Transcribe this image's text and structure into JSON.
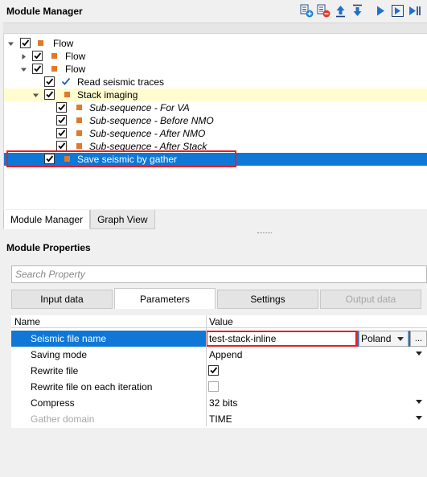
{
  "module_manager": {
    "title": "Module Manager",
    "toolbar": [
      {
        "icon": "add-module-icon"
      },
      {
        "icon": "remove-module-icon"
      },
      {
        "icon": "move-up-icon"
      },
      {
        "icon": "move-down-icon"
      },
      {
        "icon": "run-icon"
      },
      {
        "icon": "run-selected-icon"
      },
      {
        "icon": "run-to-end-icon"
      }
    ],
    "tree": {
      "root": "Flow",
      "flow_1": "Flow",
      "flow_2": "Flow",
      "read_traces": "Read seismic traces",
      "stack_imaging": "Stack imaging",
      "sub_va": "Sub-sequence - For VA",
      "sub_before_nmo": "Sub-sequence - Before NMO",
      "sub_after_nmo": "Sub-sequence - After NMO",
      "sub_after_stack": "Sub-sequence - After Stack",
      "save_seismic": "Save seismic by gather"
    },
    "bottom_tabs": [
      "Module Manager",
      "Graph View"
    ]
  },
  "module_properties": {
    "title": "Module Properties",
    "search_placeholder": "Search Property",
    "tabs": [
      "Input data",
      "Parameters",
      "Settings",
      "Output data"
    ],
    "columns": {
      "name": "Name",
      "value": "Value"
    },
    "rows": [
      {
        "name": "Seismic file name",
        "value": "test-stack-inline",
        "encoding": "Poland",
        "ellipsis": "..."
      },
      {
        "name": "Saving mode",
        "value": "Append"
      },
      {
        "name": "Rewrite file",
        "checked": true
      },
      {
        "name": "Rewrite file on each iteration",
        "checked": false
      },
      {
        "name": "Compress",
        "value": "32 bits"
      },
      {
        "name": "Gather domain",
        "value": "TIME"
      }
    ]
  },
  "colors": {
    "selection": "#0f78d7",
    "highlight_yellow": "#fffcd0",
    "module_square": "#e07a2a",
    "annotation_red": "#e0202a"
  }
}
